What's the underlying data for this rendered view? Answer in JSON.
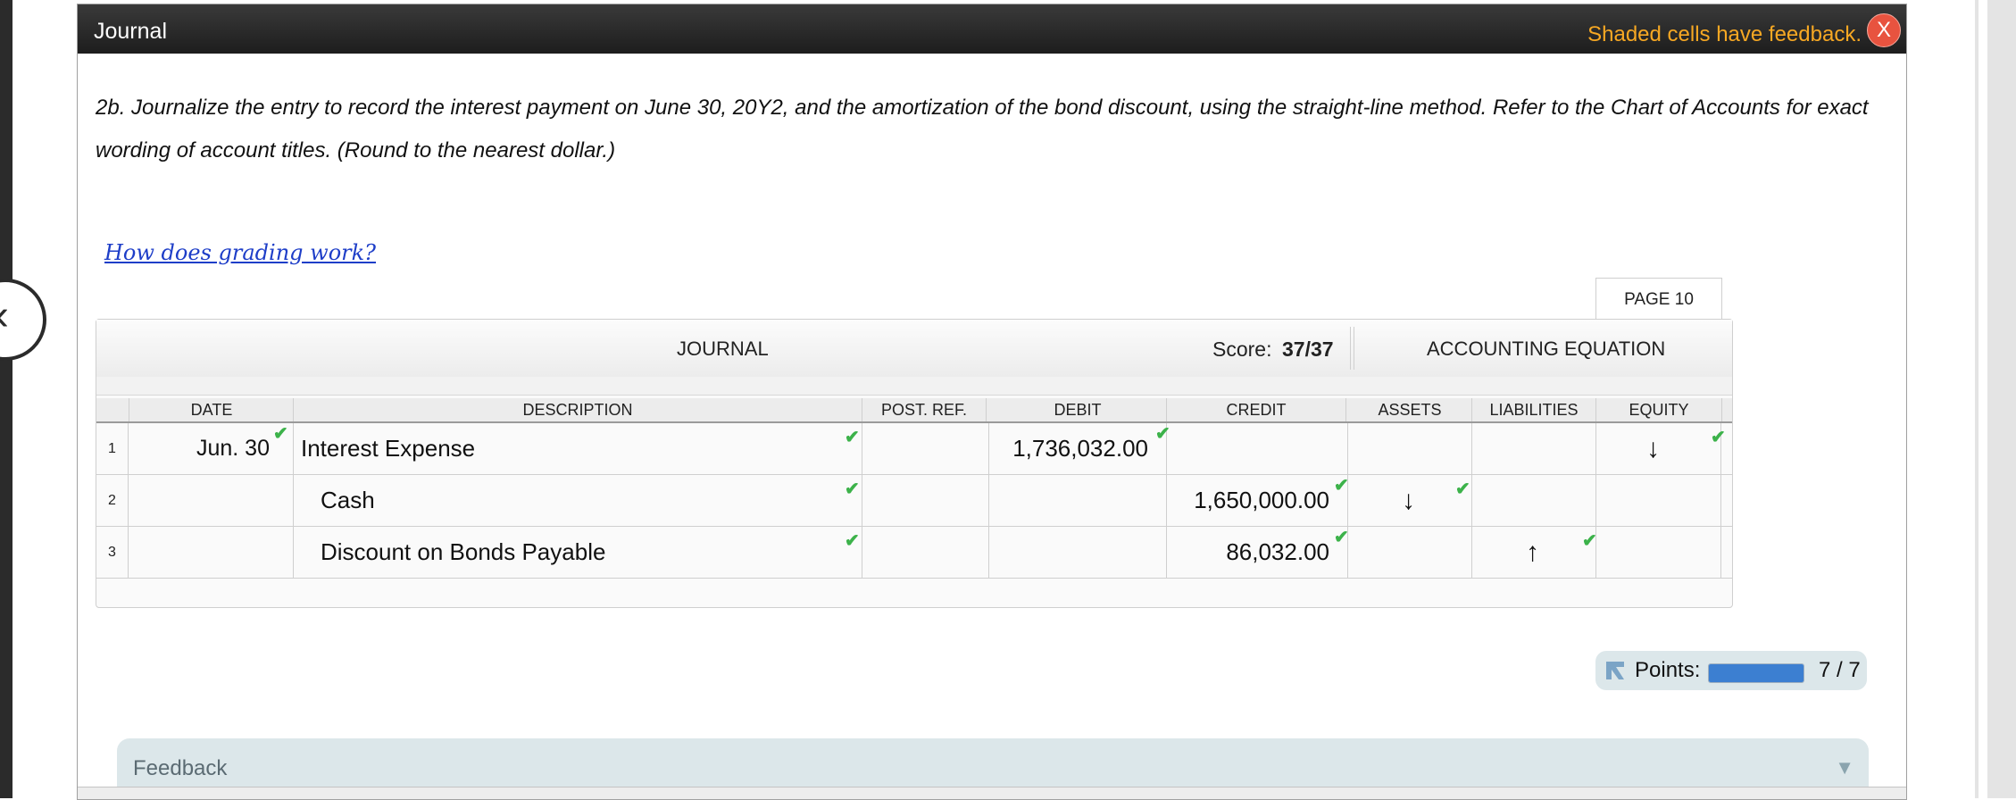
{
  "window": {
    "title": "Journal",
    "feedback_note": "Shaded cells have feedback.",
    "close_label": "X"
  },
  "prompt": {
    "text": "2b. Journalize the entry to record the interest payment on June 30, 20Y2, and the amortization of the bond discount, using the straight-line method. Refer to the Chart of Accounts for exact wording of account titles. (Round to the nearest dollar.)"
  },
  "help_link": "How does grading work?",
  "page_tab": "PAGE 10",
  "journal": {
    "title": "JOURNAL",
    "score_label": "Score:",
    "score_value": "37/37",
    "equation_title": "ACCOUNTING EQUATION",
    "columns": {
      "date": "DATE",
      "description": "DESCRIPTION",
      "post_ref": "POST. REF.",
      "debit": "DEBIT",
      "credit": "CREDIT",
      "assets": "ASSETS",
      "liabilities": "LIABILITIES",
      "equity": "EQUITY"
    },
    "rows": [
      {
        "num": "1",
        "date": "Jun. 30",
        "description": "Interest Expense",
        "post_ref": "",
        "debit": "1,736,032.00",
        "credit": "",
        "assets": "",
        "liabilities": "",
        "equity": "↓"
      },
      {
        "num": "2",
        "date": "",
        "description": "Cash",
        "post_ref": "",
        "debit": "",
        "credit": "1,650,000.00",
        "assets": "↓",
        "liabilities": "",
        "equity": ""
      },
      {
        "num": "3",
        "date": "",
        "description": "Discount on Bonds Payable",
        "post_ref": "",
        "debit": "",
        "credit": "86,032.00",
        "assets": "",
        "liabilities": "↑",
        "equity": ""
      }
    ],
    "check_glyph": "✔"
  },
  "points": {
    "label": "Points:",
    "value": "7 / 7",
    "fraction": 1.0
  },
  "feedback": {
    "label": "Feedback",
    "chevron": "▼"
  },
  "colors": {
    "accent_orange": "#f7a823",
    "check_green": "#3cb24a",
    "link_blue": "#1e3ec8",
    "close_red": "#e8533f"
  }
}
